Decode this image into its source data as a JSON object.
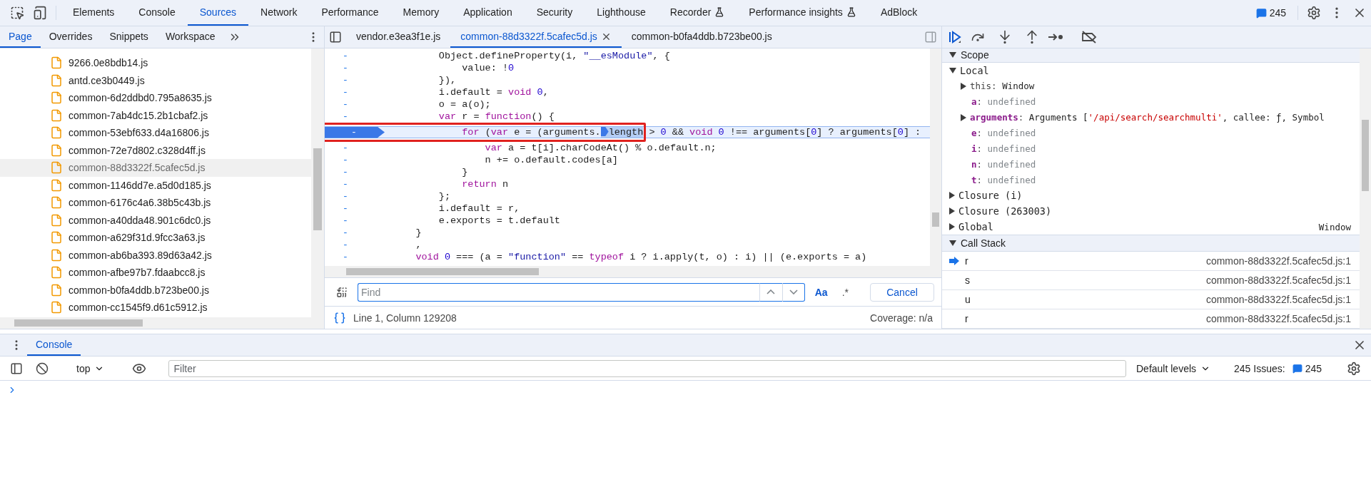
{
  "main_tabs": [
    {
      "label": "Elements",
      "selected": false,
      "experimental": false
    },
    {
      "label": "Console",
      "selected": false,
      "experimental": false
    },
    {
      "label": "Sources",
      "selected": true,
      "experimental": false
    },
    {
      "label": "Network",
      "selected": false,
      "experimental": false
    },
    {
      "label": "Performance",
      "selected": false,
      "experimental": false
    },
    {
      "label": "Memory",
      "selected": false,
      "experimental": false
    },
    {
      "label": "Application",
      "selected": false,
      "experimental": false
    },
    {
      "label": "Security",
      "selected": false,
      "experimental": false
    },
    {
      "label": "Lighthouse",
      "selected": false,
      "experimental": false
    },
    {
      "label": "Recorder",
      "selected": false,
      "experimental": true
    },
    {
      "label": "Performance insights",
      "selected": false,
      "experimental": true
    },
    {
      "label": "AdBlock",
      "selected": false,
      "experimental": false
    }
  ],
  "issues_count": "245",
  "navigator": {
    "tabs": [
      {
        "label": "Page",
        "selected": true
      },
      {
        "label": "Overrides",
        "selected": false
      },
      {
        "label": "Snippets",
        "selected": false
      },
      {
        "label": "Workspace",
        "selected": false
      }
    ],
    "files": [
      {
        "name": "9266.0e8bdb14.js",
        "selected": false
      },
      {
        "name": "antd.ce3b0449.js",
        "selected": false
      },
      {
        "name": "common-6d2ddbd0.795a8635.js",
        "selected": false
      },
      {
        "name": "common-7ab4dc15.2b1cbaf2.js",
        "selected": false
      },
      {
        "name": "common-53ebf633.d4a16806.js",
        "selected": false
      },
      {
        "name": "common-72e7d802.c328d4ff.js",
        "selected": false
      },
      {
        "name": "common-88d3322f.5cafec5d.js",
        "selected": true
      },
      {
        "name": "common-1146dd7e.a5d0d185.js",
        "selected": false
      },
      {
        "name": "common-6176c4a6.38b5c43b.js",
        "selected": false
      },
      {
        "name": "common-a40dda48.901c6dc0.js",
        "selected": false
      },
      {
        "name": "common-a629f31d.9fcc3a63.js",
        "selected": false
      },
      {
        "name": "common-ab6ba393.89d63a42.js",
        "selected": false
      },
      {
        "name": "common-afbe97b7.fdaabcc8.js",
        "selected": false
      },
      {
        "name": "common-b0fa4ddb.b723be00.js",
        "selected": false
      },
      {
        "name": "common-cc1545f9.d61c5912.js",
        "selected": false
      }
    ]
  },
  "editor": {
    "tabs": [
      {
        "label": "vendor.e3ea3f1e.js",
        "selected": false,
        "closable": false
      },
      {
        "label": "common-88d3322f.5cafec5d.js",
        "selected": true,
        "closable": true
      },
      {
        "label": "common-b0fa4ddb.b723be00.js",
        "selected": false,
        "closable": false
      }
    ],
    "lines": [
      {
        "gutter": "-",
        "breakpoint": false,
        "current": false,
        "annotated": false,
        "segments": [
          {
            "text": "        Object.defineProperty(i, ",
            "kind": "plain"
          },
          {
            "text": "\"__esModule\"",
            "kind": "string"
          },
          {
            "text": ", {",
            "kind": "plain"
          }
        ]
      },
      {
        "gutter": "-",
        "breakpoint": false,
        "current": false,
        "annotated": false,
        "segments": [
          {
            "text": "            value: !",
            "kind": "plain"
          },
          {
            "text": "0",
            "kind": "number"
          }
        ]
      },
      {
        "gutter": "-",
        "breakpoint": false,
        "current": false,
        "annotated": false,
        "segments": [
          {
            "text": "        }),",
            "kind": "plain"
          }
        ]
      },
      {
        "gutter": "-",
        "breakpoint": false,
        "current": false,
        "annotated": false,
        "segments": [
          {
            "text": "        i.default = ",
            "kind": "plain"
          },
          {
            "text": "void",
            "kind": "keyword"
          },
          {
            "text": " 0",
            "kind": "number"
          },
          {
            "text": ",",
            "kind": "plain"
          }
        ]
      },
      {
        "gutter": "-",
        "breakpoint": false,
        "current": false,
        "annotated": false,
        "segments": [
          {
            "text": "        o = a(o);",
            "kind": "plain"
          }
        ]
      },
      {
        "gutter": "-",
        "breakpoint": false,
        "current": false,
        "annotated": false,
        "segments": [
          {
            "text": "        var",
            "kind": "keyword"
          },
          {
            "text": " r = ",
            "kind": "plain"
          },
          {
            "text": "function",
            "kind": "keyword"
          },
          {
            "text": "() {",
            "kind": "plain"
          }
        ]
      },
      {
        "gutter": "-",
        "breakpoint": true,
        "current": true,
        "annotated": true,
        "segments": [
          {
            "text": "            for",
            "kind": "keyword"
          },
          {
            "text": " (",
            "kind": "plain"
          },
          {
            "text": "var",
            "kind": "keyword"
          },
          {
            "text": " e = (arguments.",
            "kind": "plain"
          },
          {
            "text": "length",
            "kind": "selected"
          },
          {
            "text": " > ",
            "kind": "plain"
          },
          {
            "text": "0",
            "kind": "number"
          },
          {
            "text": " && ",
            "kind": "plain"
          },
          {
            "text": "void",
            "kind": "keyword"
          },
          {
            "text": " 0",
            "kind": "number"
          },
          {
            "text": " !== arguments[",
            "kind": "plain"
          },
          {
            "text": "0",
            "kind": "number"
          },
          {
            "text": "] ? arguments[",
            "kind": "plain"
          },
          {
            "text": "0",
            "kind": "number"
          },
          {
            "text": "] :",
            "kind": "plain"
          }
        ]
      },
      {
        "gutter": "-",
        "breakpoint": false,
        "current": false,
        "annotated": false,
        "segments": [
          {
            "text": "                var",
            "kind": "keyword"
          },
          {
            "text": " a = t[i].charCodeAt() % o.default.n;",
            "kind": "plain"
          }
        ]
      },
      {
        "gutter": "-",
        "breakpoint": false,
        "current": false,
        "annotated": false,
        "segments": [
          {
            "text": "                n += o.default.codes[a]",
            "kind": "plain"
          }
        ]
      },
      {
        "gutter": "-",
        "breakpoint": false,
        "current": false,
        "annotated": false,
        "segments": [
          {
            "text": "            }",
            "kind": "plain"
          }
        ]
      },
      {
        "gutter": "-",
        "breakpoint": false,
        "current": false,
        "annotated": false,
        "segments": [
          {
            "text": "            return",
            "kind": "keyword"
          },
          {
            "text": " n",
            "kind": "plain"
          }
        ]
      },
      {
        "gutter": "-",
        "breakpoint": false,
        "current": false,
        "annotated": false,
        "segments": [
          {
            "text": "        };",
            "kind": "plain"
          }
        ]
      },
      {
        "gutter": "-",
        "breakpoint": false,
        "current": false,
        "annotated": false,
        "segments": [
          {
            "text": "        i.default = r,",
            "kind": "plain"
          }
        ]
      },
      {
        "gutter": "-",
        "breakpoint": false,
        "current": false,
        "annotated": false,
        "segments": [
          {
            "text": "        e.exports = t.default",
            "kind": "plain"
          }
        ]
      },
      {
        "gutter": "-",
        "breakpoint": false,
        "current": false,
        "annotated": false,
        "segments": [
          {
            "text": "    }",
            "kind": "plain"
          }
        ]
      },
      {
        "gutter": "-",
        "breakpoint": false,
        "current": false,
        "annotated": false,
        "segments": [
          {
            "text": "    ,",
            "kind": "plain"
          }
        ]
      },
      {
        "gutter": "-",
        "breakpoint": false,
        "current": false,
        "annotated": false,
        "segments": [
          {
            "text": "    void",
            "kind": "keyword"
          },
          {
            "text": " 0",
            "kind": "number"
          },
          {
            "text": " === (a = ",
            "kind": "plain"
          },
          {
            "text": "\"function\"",
            "kind": "string"
          },
          {
            "text": " == ",
            "kind": "plain"
          },
          {
            "text": "typeof",
            "kind": "keyword"
          },
          {
            "text": " i ? i.apply(t, o) : i) || (e.exports = a)",
            "kind": "plain"
          }
        ]
      }
    ],
    "find": {
      "placeholder": "Find",
      "match_case": "Aa",
      "regex": ".*",
      "cancel": "Cancel"
    },
    "status": {
      "position": "Line 1, Column 129208",
      "coverage": "Coverage: n/a"
    }
  },
  "debugger": {
    "scope": {
      "title": "Scope",
      "expanded": true,
      "groups": [
        {
          "label": "Local",
          "expanded": true,
          "children": [
            {
              "name": "this",
              "kind": "object",
              "internal": true,
              "expanded": false,
              "value": [
                {
                  "text": ": ",
                  "kind": "punct"
                },
                {
                  "text": "Window",
                  "kind": "plain"
                }
              ]
            },
            {
              "name": "a",
              "kind": "primitive",
              "internal": false,
              "value": [
                {
                  "text": ": ",
                  "kind": "punct"
                },
                {
                  "text": "undefined",
                  "kind": "undefined"
                }
              ]
            },
            {
              "name": "arguments",
              "kind": "object",
              "internal": false,
              "expanded": false,
              "value": [
                {
                  "text": ": ",
                  "kind": "punct"
                },
                {
                  "text": "Arguments [",
                  "kind": "plain"
                },
                {
                  "text": "'/api/search/searchmulti'",
                  "kind": "string"
                },
                {
                  "text": ", callee: ƒ, Symbol",
                  "kind": "plain"
                }
              ]
            },
            {
              "name": "e",
              "kind": "primitive",
              "internal": false,
              "value": [
                {
                  "text": ": ",
                  "kind": "punct"
                },
                {
                  "text": "undefined",
                  "kind": "undefined"
                }
              ]
            },
            {
              "name": "i",
              "kind": "primitive",
              "internal": false,
              "value": [
                {
                  "text": ": ",
                  "kind": "punct"
                },
                {
                  "text": "undefined",
                  "kind": "undefined"
                }
              ]
            },
            {
              "name": "n",
              "kind": "primitive",
              "internal": false,
              "value": [
                {
                  "text": ": ",
                  "kind": "punct"
                },
                {
                  "text": "undefined",
                  "kind": "undefined"
                }
              ]
            },
            {
              "name": "t",
              "kind": "primitive",
              "internal": false,
              "value": [
                {
                  "text": ": ",
                  "kind": "punct"
                },
                {
                  "text": "undefined",
                  "kind": "undefined"
                }
              ]
            }
          ]
        },
        {
          "label": "Closure (i)",
          "expanded": false
        },
        {
          "label": "Closure (263003)",
          "expanded": false
        },
        {
          "label": "Global",
          "expanded": false,
          "value": "Window"
        }
      ]
    },
    "call_stack": {
      "title": "Call Stack",
      "expanded": true,
      "frames": [
        {
          "name": "r",
          "location": "common-88d3322f.5cafec5d.js:1",
          "selected": true
        },
        {
          "name": "s",
          "location": "common-88d3322f.5cafec5d.js:1",
          "selected": false
        },
        {
          "name": "u",
          "location": "common-88d3322f.5cafec5d.js:1",
          "selected": false
        },
        {
          "name": "r",
          "location": "common-88d3322f.5cafec5d.js:1",
          "selected": false
        }
      ]
    }
  },
  "drawer": {
    "tabs": [
      {
        "label": "Console",
        "selected": true
      }
    ],
    "context": "top",
    "filter_placeholder": "Filter",
    "levels": "Default levels",
    "issues_label": "245 Issues:",
    "issues_count": "245"
  }
}
